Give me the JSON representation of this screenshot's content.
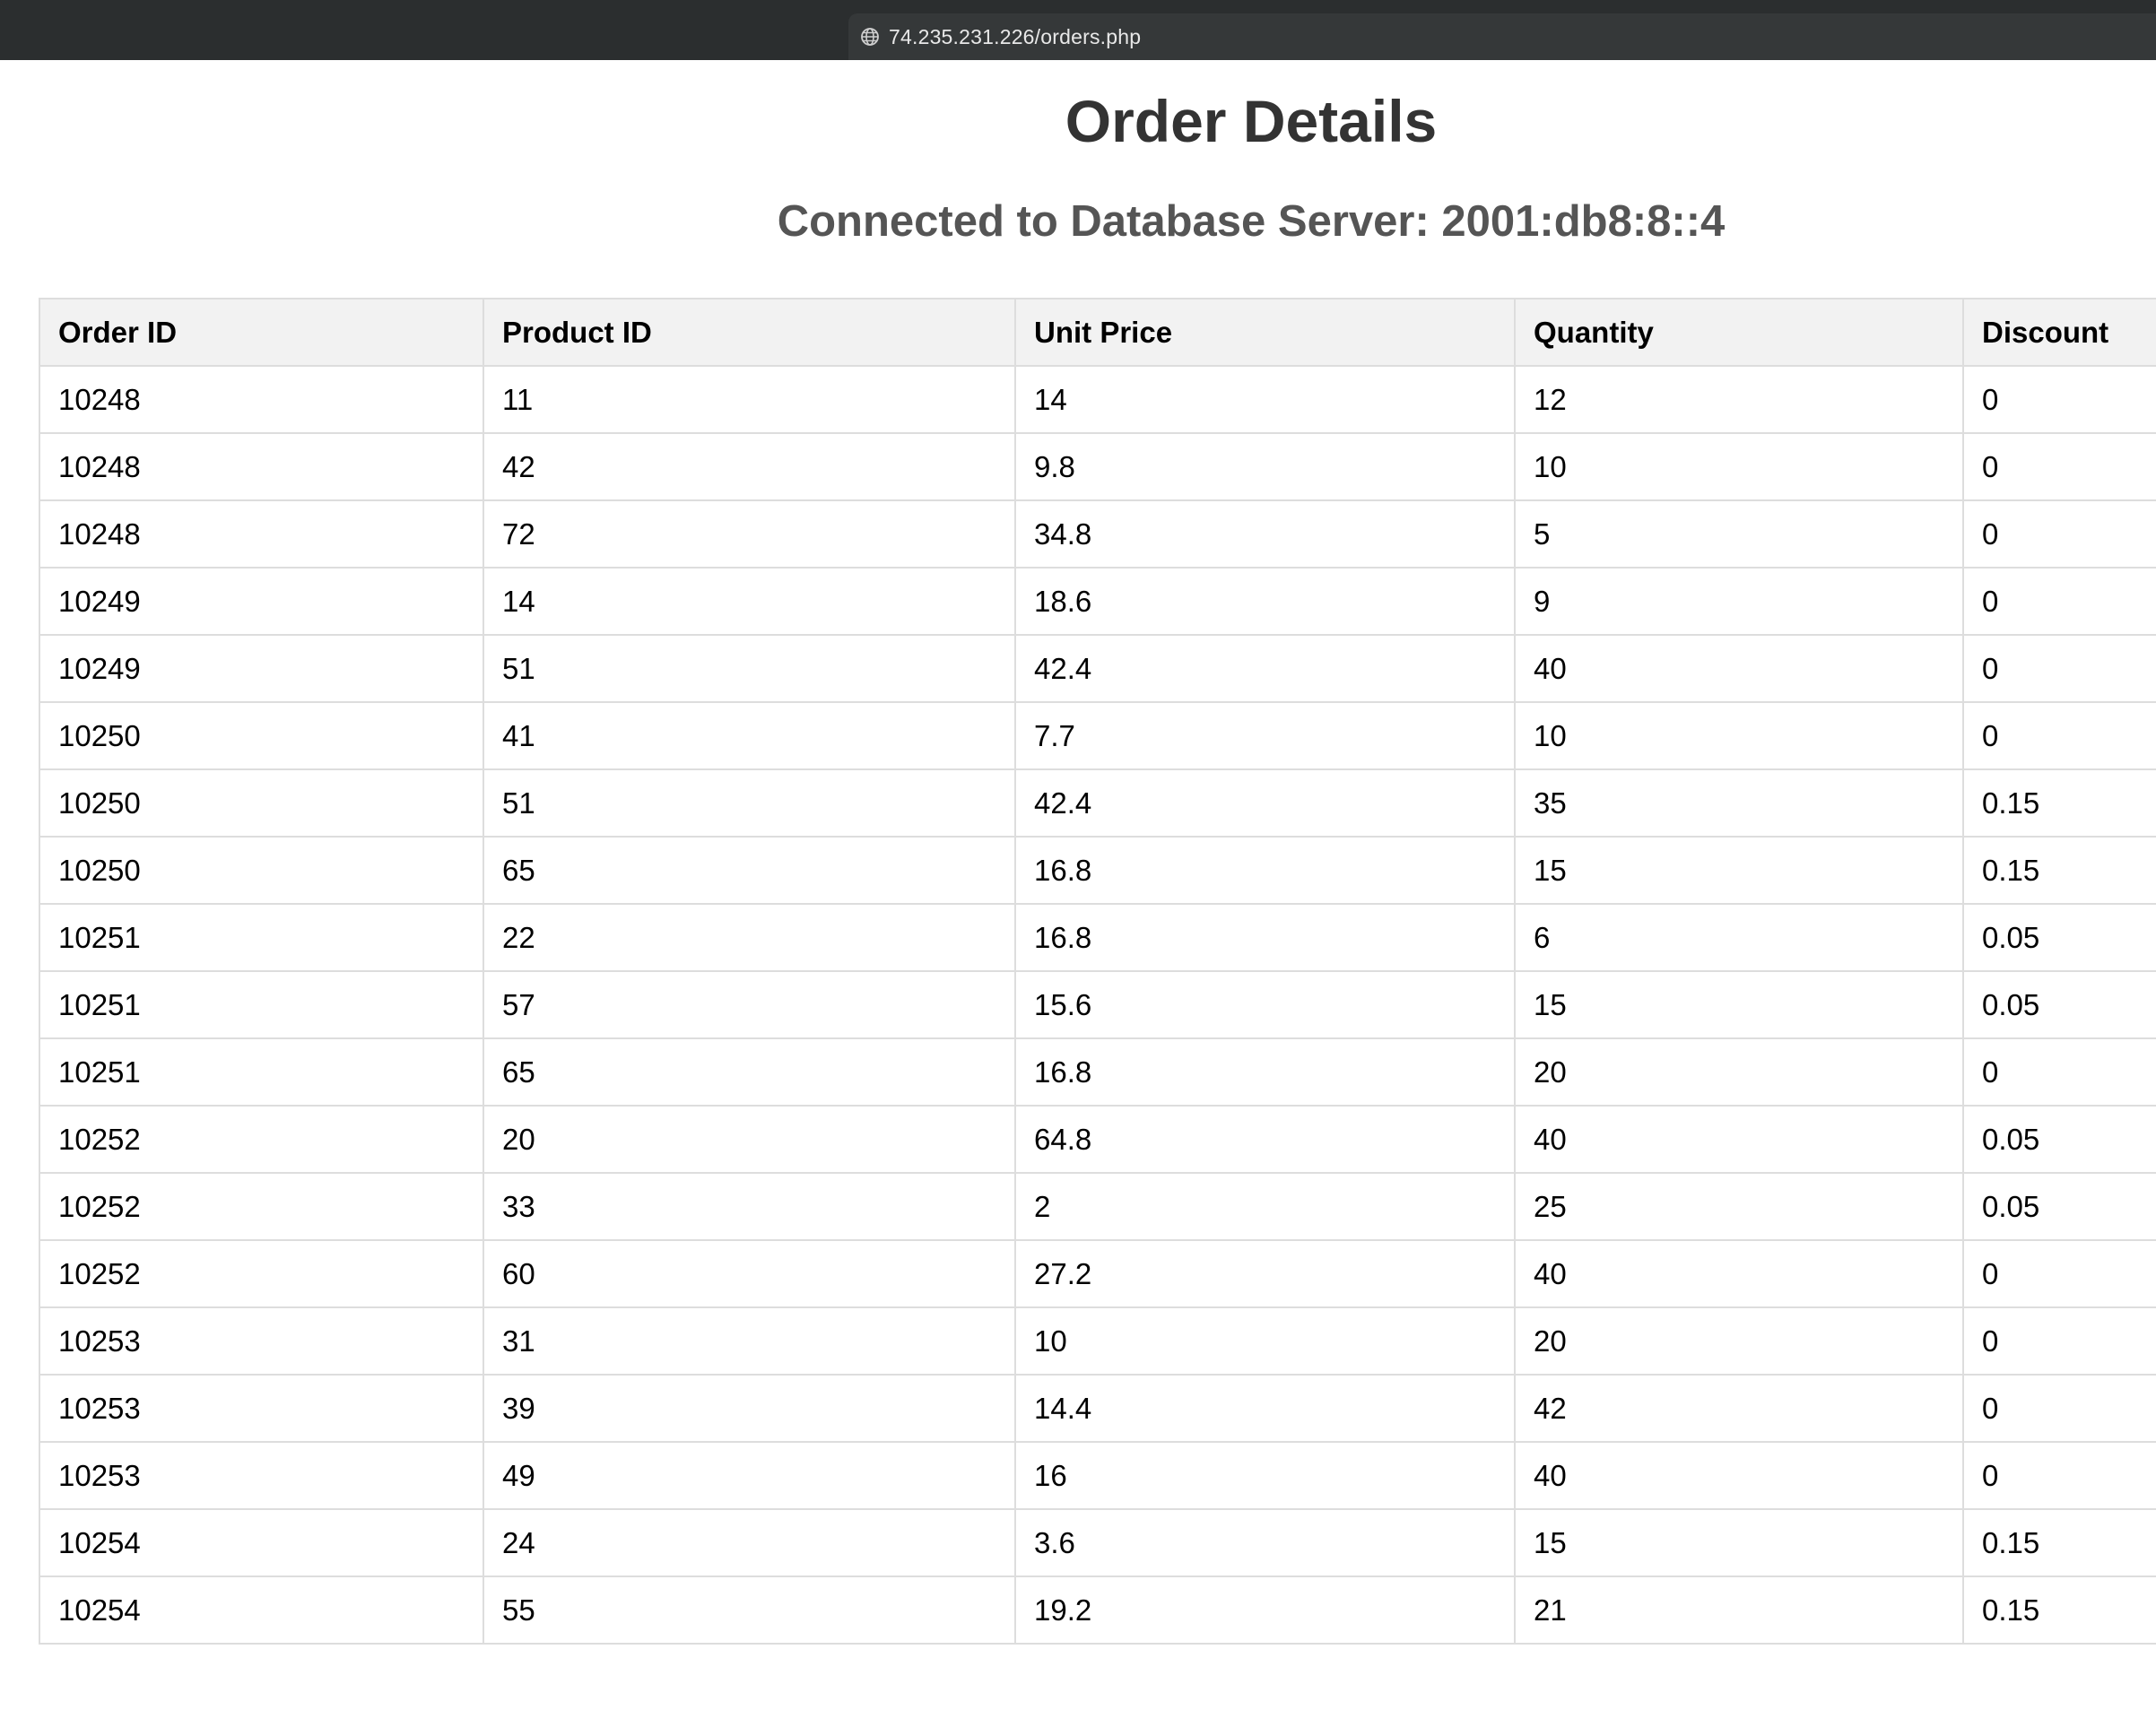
{
  "browser": {
    "url": "74.235.231.226/orders.php"
  },
  "page": {
    "title": "Order Details",
    "db_status": "Connected to Database Server: 2001:db8:8::4"
  },
  "table": {
    "headers": [
      "Order ID",
      "Product ID",
      "Unit Price",
      "Quantity",
      "Discount"
    ],
    "rows": [
      [
        "10248",
        "11",
        "14",
        "12",
        "0"
      ],
      [
        "10248",
        "42",
        "9.8",
        "10",
        "0"
      ],
      [
        "10248",
        "72",
        "34.8",
        "5",
        "0"
      ],
      [
        "10249",
        "14",
        "18.6",
        "9",
        "0"
      ],
      [
        "10249",
        "51",
        "42.4",
        "40",
        "0"
      ],
      [
        "10250",
        "41",
        "7.7",
        "10",
        "0"
      ],
      [
        "10250",
        "51",
        "42.4",
        "35",
        "0.15"
      ],
      [
        "10250",
        "65",
        "16.8",
        "15",
        "0.15"
      ],
      [
        "10251",
        "22",
        "16.8",
        "6",
        "0.05"
      ],
      [
        "10251",
        "57",
        "15.6",
        "15",
        "0.05"
      ],
      [
        "10251",
        "65",
        "16.8",
        "20",
        "0"
      ],
      [
        "10252",
        "20",
        "64.8",
        "40",
        "0.05"
      ],
      [
        "10252",
        "33",
        "2",
        "25",
        "0.05"
      ],
      [
        "10252",
        "60",
        "27.2",
        "40",
        "0"
      ],
      [
        "10253",
        "31",
        "10",
        "20",
        "0"
      ],
      [
        "10253",
        "39",
        "14.4",
        "42",
        "0"
      ],
      [
        "10253",
        "49",
        "16",
        "40",
        "0"
      ],
      [
        "10254",
        "24",
        "3.6",
        "15",
        "0.15"
      ],
      [
        "10254",
        "55",
        "19.2",
        "21",
        "0.15"
      ]
    ]
  }
}
